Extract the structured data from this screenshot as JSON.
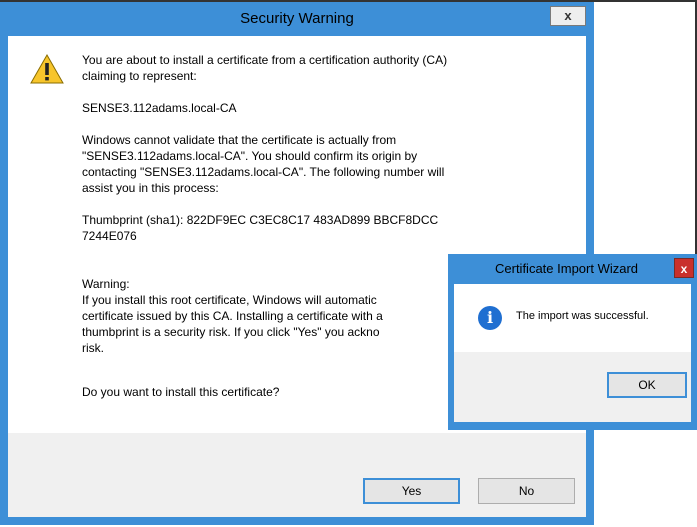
{
  "security_warning": {
    "title": "Security Warning",
    "close_glyph": "x",
    "intro_line1": "You are about to install a certificate from a certification authority (CA)",
    "intro_line2": "claiming to represent:",
    "ca_name": "SENSE3.112adams.local-CA",
    "validate_line1": "Windows cannot validate that the certificate is actually from",
    "validate_line2": "\"SENSE3.112adams.local-CA\". You should confirm its origin by",
    "validate_line3": "contacting \"SENSE3.112adams.local-CA\". The following number will",
    "validate_line4": "assist you in this process:",
    "thumbprint_line1": "Thumbprint (sha1): 822DF9EC C3EC8C17 483AD899 BBCF8DCC",
    "thumbprint_line2": "7244E076",
    "warning_heading": "Warning:",
    "warning_line1": "If you install this root certificate, Windows will automatic",
    "warning_line2": "certificate issued by this CA. Installing a certificate with a",
    "warning_line3": "thumbprint is a security risk. If you click \"Yes\" you ackno",
    "warning_line4": "risk.",
    "question": "Do you want to install this certificate?",
    "yes_label": "Yes",
    "no_label": "No",
    "icon": "warning-triangle-icon"
  },
  "import_wizard": {
    "title": "Certificate Import Wizard",
    "close_glyph": "x",
    "message": "The import was successful.",
    "ok_label": "OK",
    "icon": "info-icon"
  },
  "colors": {
    "frame_blue": "#3d8fd7",
    "close_red": "#c9302c",
    "info_blue": "#1f6fd1",
    "warning_yellow": "#f7c52b"
  }
}
